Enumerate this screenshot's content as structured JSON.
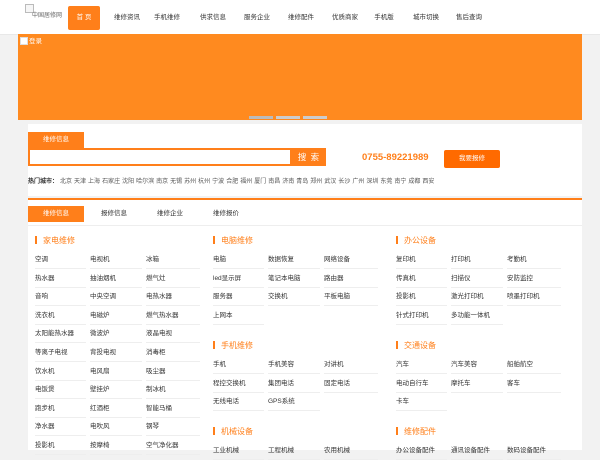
{
  "header": {
    "logo_alt": "中国居修网",
    "nav": [
      {
        "label": "首 页",
        "active": true
      },
      {
        "label": "维修资讯"
      },
      {
        "label": "手机维修"
      },
      {
        "label": "供求信息"
      },
      {
        "label": "服务企业"
      },
      {
        "label": "维修配件"
      },
      {
        "label": "优质商家"
      },
      {
        "label": "手机版"
      },
      {
        "label": "城市切换"
      },
      {
        "label": "售后查询"
      }
    ]
  },
  "banner": {
    "alt": "登录"
  },
  "search": {
    "tab_label": "维修信息",
    "input_value": "",
    "button_label": "搜 索",
    "phone": "0755-89221989",
    "repair_button": "我要报修",
    "hot_label": "热门城市：",
    "cities": [
      "北京",
      "天津",
      "上海",
      "石家庄",
      "沈阳",
      "哈尔滨",
      "南京",
      "无锡",
      "苏州",
      "杭州",
      "宁波",
      "合肥",
      "福州",
      "厦门",
      "南昌",
      "济南",
      "青岛",
      "郑州",
      "武汉",
      "长沙",
      "广州",
      "深圳",
      "东莞",
      "南宁",
      "成都",
      "西安"
    ]
  },
  "tabs": [
    "维修信息",
    "报修信息",
    "维修企业",
    "维修报价"
  ],
  "categories": {
    "appliance": {
      "title": "家电维修",
      "items": [
        "空调",
        "电视机",
        "冰箱",
        "热水器",
        "抽油烟机",
        "燃气灶",
        "音响",
        "中央空调",
        "电热水器",
        "洗衣机",
        "电磁炉",
        "燃气热水器",
        "太阳能热水器",
        "微波炉",
        "液晶电视",
        "等离子电视",
        "背投电视",
        "消毒柜",
        "饮水机",
        "电风扇",
        "吸尘器",
        "电饭煲",
        "壁挂炉",
        "制冰机",
        "跑步机",
        "红酒柜",
        "智能马桶",
        "净水器",
        "电吹风",
        "钢琴",
        "投影机",
        "按摩椅",
        "空气净化器"
      ]
    },
    "computer": {
      "title": "电脑维修",
      "items": [
        "电脑",
        "数据恢复",
        "网络设备",
        "led显示屏",
        "笔记本电脑",
        "路由器",
        "服务器",
        "交换机",
        "平板电脑",
        "上网本"
      ]
    },
    "phone": {
      "title": "手机维修",
      "items": [
        "手机",
        "手机美容",
        "对讲机",
        "程控交换机",
        "集团电话",
        "固定电话",
        "无线电话",
        "GPS系统"
      ]
    },
    "machinery": {
      "title": "机械设备",
      "items": [
        "工业机械",
        "工程机械",
        "农用机械"
      ]
    },
    "office": {
      "title": "办公设备",
      "items": [
        "复印机",
        "打印机",
        "考勤机",
        "传真机",
        "扫描仪",
        "安防监控",
        "投影机",
        "激光打印机",
        "喷墨打印机",
        "针式打印机",
        "多功能一体机"
      ]
    },
    "transport": {
      "title": "交通设备",
      "items": [
        "汽车",
        "汽车美容",
        "船舶航空",
        "电动自行车",
        "摩托车",
        "客车",
        "卡车"
      ]
    },
    "parts": {
      "title": "维修配件",
      "items": [
        "办公设备配件",
        "通讯设备配件",
        "数码设备配件"
      ]
    }
  },
  "colors": {
    "accent": "#ff7f1a",
    "banner": "#ff8a1f"
  }
}
